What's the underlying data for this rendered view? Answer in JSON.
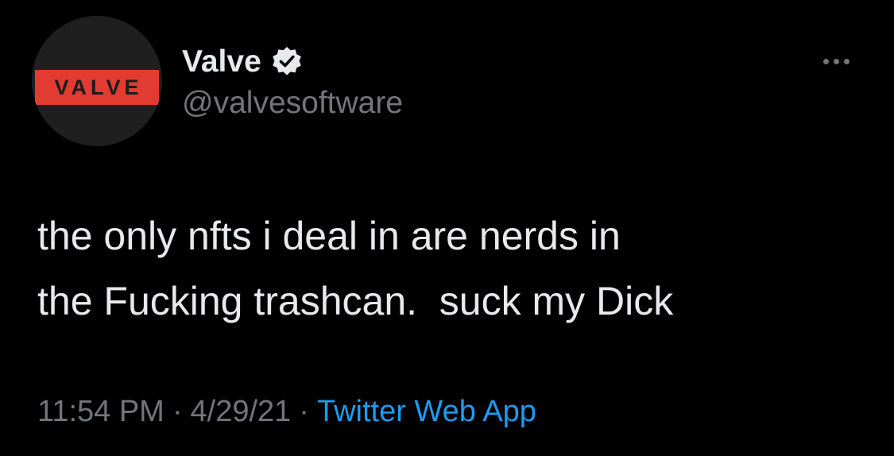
{
  "tweet": {
    "author": {
      "display_name": "Valve",
      "handle": "@valvesoftware",
      "verified": true,
      "avatar_logo_text": "VALVE",
      "avatar_logo_color": "#e23b31"
    },
    "text": "the only nfts i deal in are nerds in\nthe Fucking trashcan.  suck my Dick",
    "time": "11:54 PM",
    "date": "4/29/21",
    "source": "Twitter Web App",
    "separator": "·",
    "more_icon": "more-horizontal-icon"
  },
  "colors": {
    "background": "#000000",
    "primary_text": "#e7e9ea",
    "secondary_text": "#71767b",
    "link": "#1d9bf0"
  }
}
